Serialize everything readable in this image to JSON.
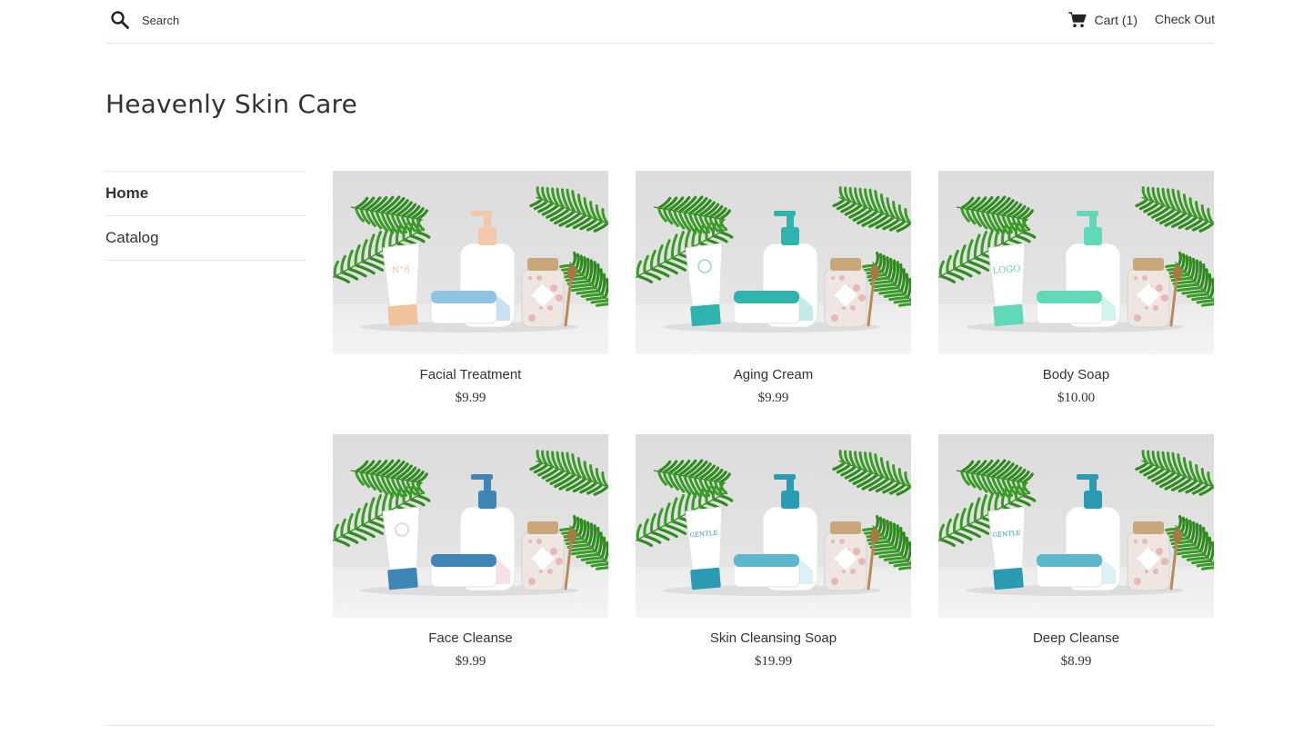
{
  "header": {
    "search_placeholder": "Search",
    "cart_label": "Cart (1)",
    "checkout_label": "Check Out"
  },
  "site": {
    "title": "Heavenly Skin Care"
  },
  "sidebar": {
    "items": [
      {
        "label": "Home",
        "active": true
      },
      {
        "label": "Catalog",
        "active": false
      }
    ]
  },
  "products": [
    {
      "title": "Facial Treatment",
      "price": "$9.99",
      "tube_color": "#f2c29b",
      "tube_label": "N°8",
      "jar_color": "#8fc3e6",
      "pump_color": "#f3c8a8",
      "accent": "#9cc8e8"
    },
    {
      "title": "Aging Cream",
      "price": "$9.99",
      "tube_color": "#2fb3ad",
      "tube_label": "",
      "jar_color": "#2fb3ad",
      "pump_color": "#2fb3ad",
      "accent": "#8fdad3"
    },
    {
      "title": "Body Soap",
      "price": "$10.00",
      "tube_color": "#5fd9b8",
      "tube_label": "LOGO",
      "jar_color": "#5fd9b8",
      "pump_color": "#5fd9b8",
      "accent": "#a8efd8"
    },
    {
      "title": "Face Cleanse",
      "price": "$9.99",
      "tube_color": "#3f86b8",
      "tube_label": "",
      "jar_color": "#3f86b8",
      "pump_color": "#3f86b8",
      "accent": "#f2c6d6"
    },
    {
      "title": "Skin Cleansing Soap",
      "price": "$19.99",
      "tube_color": "#2b9bb4",
      "tube_label": "GENTLE",
      "jar_color": "#5db7cc",
      "pump_color": "#2b9bb4",
      "accent": "#bfe3ec"
    },
    {
      "title": "Deep Cleanse",
      "price": "$8.99",
      "tube_color": "#2b9bb4",
      "tube_label": "GENTLE",
      "jar_color": "#5db7cc",
      "pump_color": "#2b9bb4",
      "accent": "#bfe3ec"
    }
  ]
}
